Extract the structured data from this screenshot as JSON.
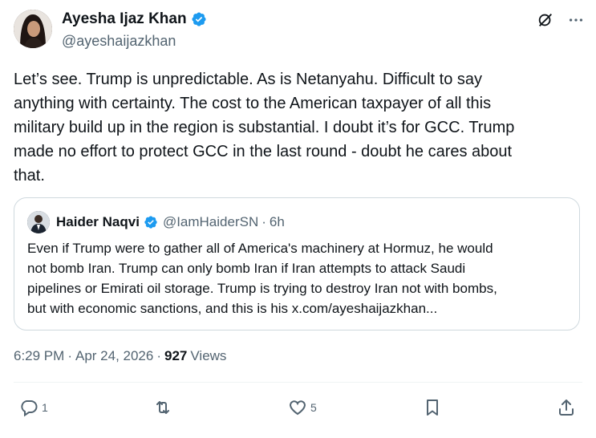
{
  "author": {
    "name": "Ayesha Ijaz Khan",
    "handle": "@ayeshaijazkhan",
    "verified": true
  },
  "tweet_text": "Let’s see. Trump is unpredictable. As is Netanyahu. Difficult to say\nanything with certainty. The cost to the American taxpayer of all this\nmilitary build up in the region is substantial. I doubt it’s for GCC. Trump\nmade no effort to protect GCC in the last round - doubt he cares about\nthat.",
  "quoted": {
    "name": "Haider Naqvi",
    "handle": "@IamHaiderSN",
    "dot": "·",
    "time": "6h",
    "text": "Even if Trump were to gather all of America's machinery at Hormuz, he would\nnot bomb Iran. Trump can only bomb Iran if Iran attempts to attack Saudi\npipelines or Emirati oil storage. Trump is trying to destroy Iran not with bombs,\nbut with economic sanctions, and this is his x.com/ayeshaijazkhan..."
  },
  "meta": {
    "time": "6:29 PM",
    "sep1": "·",
    "date": "Apr 24, 2026",
    "sep2": "·",
    "views_count": "927",
    "views_label": "Views"
  },
  "actions": {
    "reply_count": "1",
    "repost_count": "",
    "like_count": "5"
  },
  "icons": {
    "top": [
      "grok-icon",
      "more-icon"
    ],
    "actions": [
      "reply-icon",
      "repost-icon",
      "like-icon",
      "bookmark-icon",
      "share-icon"
    ]
  },
  "colors": {
    "text": "#0f1419",
    "secondary": "#536471",
    "verified": "#1d9bf0",
    "border": "#cfd9de"
  }
}
